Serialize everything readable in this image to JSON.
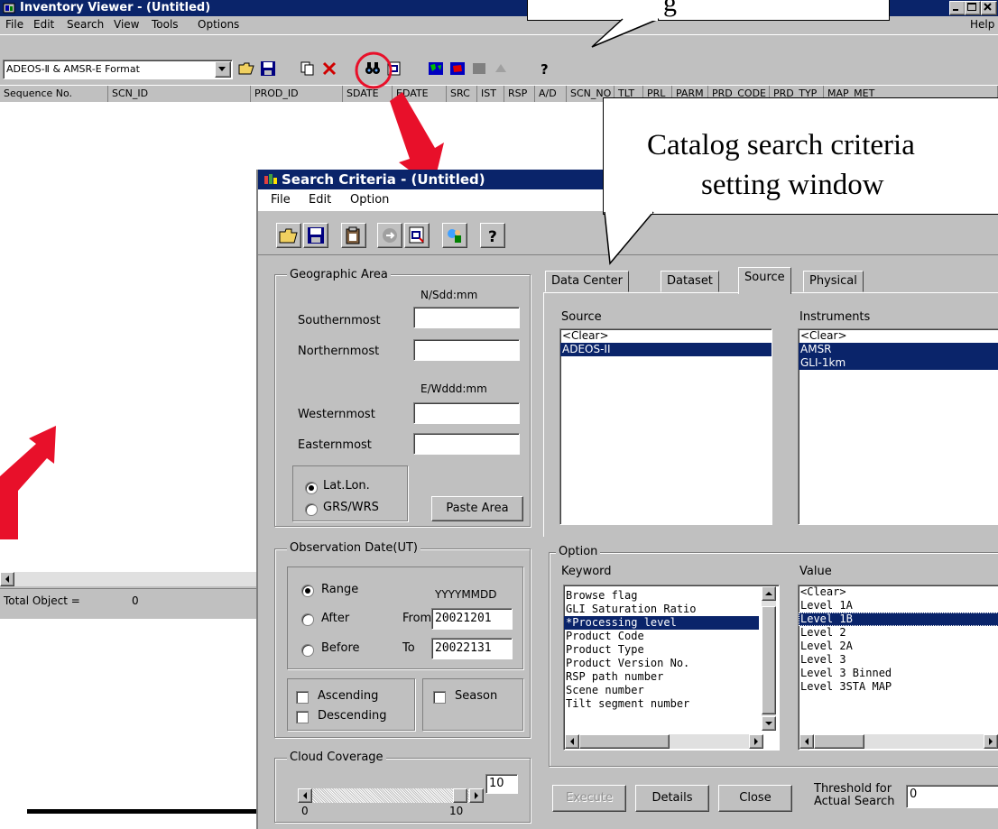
{
  "inventory": {
    "title": "Inventory Viewer - (Untitled)",
    "menu": [
      "File",
      "Edit",
      "Search",
      "View",
      "Tools",
      "Options"
    ],
    "help": "Help",
    "format_select": "ADEOS-Ⅱ & AMSR-E Format",
    "columns": [
      "Sequence No.",
      "SCN_ID",
      "PROD_ID",
      "SDATE",
      "EDATE",
      "SRC",
      "IST",
      "RSP",
      "A/D",
      "SCN_NO",
      "TLT",
      "PRL",
      "PARM",
      "PRD_CODE",
      "PRD_TYP",
      "MAP_MET"
    ],
    "status": "Total Object =",
    "status_count": "0"
  },
  "search": {
    "title": "Search Criteria - (Untitled)",
    "menu": [
      "File",
      "Edit",
      "Option"
    ],
    "geo": {
      "title": "Geographic Area",
      "ns_format": "N/Sdd:mm",
      "ew_format": "E/Wddd:mm",
      "southernmost": "Southernmost",
      "northernmost": "Northernmost",
      "westernmost": "Westernmost",
      "easternmost": "Easternmost",
      "latlon": "Lat.Lon.",
      "grswrs": "GRS/WRS",
      "paste_area": "Paste Area"
    },
    "obs": {
      "title": "Observation Date(UT)",
      "range": "Range",
      "after": "After",
      "before": "Before",
      "date_format": "YYYYMMDD",
      "from": "From",
      "to": "To",
      "from_value": "20021201",
      "to_value": "20022131",
      "ascending": "Ascending",
      "descending": "Descending",
      "season": "Season"
    },
    "cloud": {
      "title": "Cloud Coverage",
      "min": "0",
      "max": "10",
      "value": "10"
    },
    "tabs": [
      "Data Center",
      "Dataset",
      "Source",
      "Physical"
    ],
    "source": {
      "label": "Source",
      "items": [
        "<Clear>",
        "ADEOS-II"
      ]
    },
    "instruments": {
      "label": "Instruments",
      "items": [
        "<Clear>",
        "AMSR",
        "GLI-1km"
      ]
    },
    "option": {
      "title": "Option",
      "keyword_label": "Keyword",
      "value_label": "Value",
      "keywords": [
        " Browse flag",
        " GLI Saturation Ratio",
        "*Processing level",
        " Product Code",
        " Product Type",
        " Product Version No.",
        " RSP path number",
        " Scene number",
        " Tilt segment number"
      ],
      "values": [
        "<Clear>",
        "Level 1A",
        "Level 1B",
        "Level 2",
        "Level 2A",
        "Level 3",
        "Level 3 Binned",
        "Level 3STA MAP"
      ]
    },
    "buttons": {
      "execute": "Execute",
      "details": "Details",
      "close": "Close"
    },
    "threshold_label_1": "Threshold for",
    "threshold_label_2": "Actual Search",
    "threshold_value": "0"
  },
  "callouts": {
    "top_fragment": "g",
    "catalog_line1": "Catalog  search criteria",
    "catalog_line2": "setting window"
  },
  "colors": {
    "titlebar": "#0a246a",
    "window": "#c0c0c0",
    "selection": "#0a246a",
    "arrow": "#e8102a"
  }
}
